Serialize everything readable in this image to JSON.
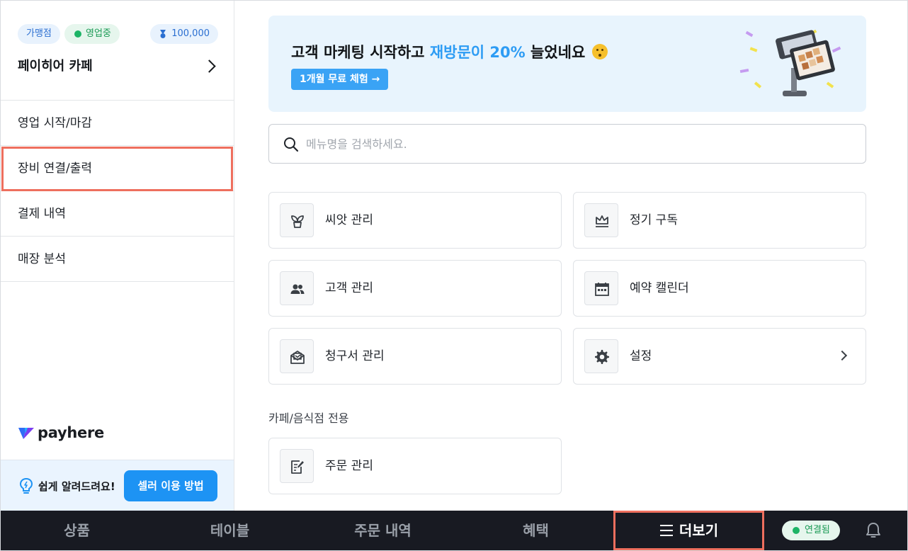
{
  "sidebar": {
    "badges": {
      "franchise": "가맹점",
      "status": "영업중",
      "points": "100,000"
    },
    "store_name": "페이히어 카페",
    "menu": [
      {
        "label": "영업 시작/마감"
      },
      {
        "label": "장비 연결/출력"
      },
      {
        "label": "결제 내역"
      },
      {
        "label": "매장 분석"
      }
    ],
    "brand": "payhere",
    "help": {
      "text": "쉽게 알려드려요!",
      "button": "셀러 이용 방법"
    }
  },
  "banner": {
    "title_pre": "고객 마케팅 시작하고 ",
    "title_highlight": "재방문이 20%",
    "title_post": " 늘었네요",
    "cta": "1개월 무료 체험 →"
  },
  "search": {
    "placeholder": "메뉴명을 검색하세요.",
    "value": ""
  },
  "cards": [
    {
      "label": "씨앗 관리",
      "icon": "sprout-icon"
    },
    {
      "label": "정기 구독",
      "icon": "crown-icon"
    },
    {
      "label": "고객 관리",
      "icon": "people-icon"
    },
    {
      "label": "예약 캘린더",
      "icon": "calendar-icon"
    },
    {
      "label": "청구서 관리",
      "icon": "invoice-mail-icon"
    },
    {
      "label": "설정",
      "icon": "gear-icon"
    }
  ],
  "section": {
    "title": "카페/음식점 전용",
    "cards": [
      {
        "label": "주문 관리",
        "icon": "order-edit-icon"
      }
    ]
  },
  "bottom_nav": {
    "tabs": [
      {
        "label": "상품"
      },
      {
        "label": "테이블"
      },
      {
        "label": "주문 내역"
      },
      {
        "label": "혜택"
      },
      {
        "label": "더보기"
      }
    ],
    "connection": "연결됨"
  },
  "colors": {
    "accent_blue": "#1d93f4",
    "highlight_blue": "#2d9cf4",
    "selection_outline": "#ee6f5e",
    "nav_bg": "#181a22",
    "status_green": "#1db466"
  }
}
